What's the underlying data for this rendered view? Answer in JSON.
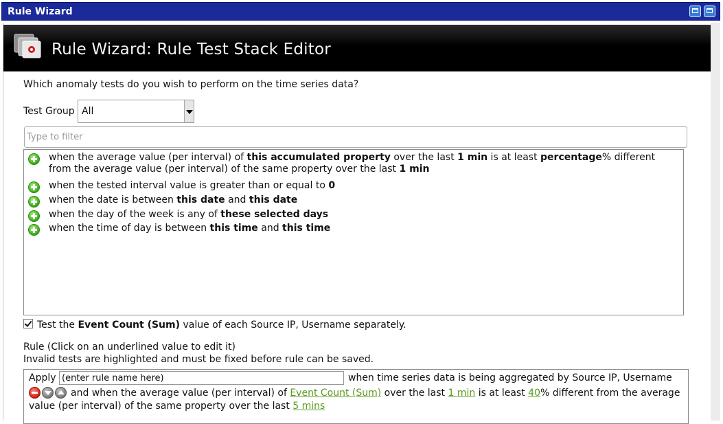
{
  "window": {
    "title": "Rule Wizard"
  },
  "header": {
    "title": "Rule Wizard: Rule Test Stack Editor"
  },
  "question": "Which anomaly tests do you wish to perform on the time series data?",
  "test_group": {
    "label": "Test Group",
    "selected": "All"
  },
  "filter": {
    "placeholder": "Type to filter",
    "value": ""
  },
  "tests": [
    {
      "parts": [
        {
          "t": "when the average value (per interval) of "
        },
        {
          "t": "this accumulated property",
          "b": true
        },
        {
          "t": " over the last "
        },
        {
          "t": "1 min",
          "b": true
        },
        {
          "t": " is at least "
        },
        {
          "t": "percentage",
          "b": true
        },
        {
          "t": "% different from the average value (per interval) of the same property over the last "
        },
        {
          "t": "1 min",
          "b": true
        }
      ]
    },
    {
      "parts": [
        {
          "t": "when the tested interval value is greater than or equal to "
        },
        {
          "t": "0",
          "b": true
        }
      ]
    },
    {
      "parts": [
        {
          "t": "when the date is between "
        },
        {
          "t": "this date",
          "b": true
        },
        {
          "t": " and "
        },
        {
          "t": "this date",
          "b": true
        }
      ]
    },
    {
      "parts": [
        {
          "t": "when the day of the week is any of "
        },
        {
          "t": "these selected days",
          "b": true
        }
      ]
    },
    {
      "parts": [
        {
          "t": "when the time of day is between "
        },
        {
          "t": "this time",
          "b": true
        },
        {
          "t": " and "
        },
        {
          "t": "this time",
          "b": true
        }
      ]
    }
  ],
  "separate_checkbox": {
    "checked": true,
    "prefix": "Test the ",
    "bold": "Event Count (Sum)",
    "suffix": " value of each Source IP, Username separately."
  },
  "rule": {
    "heading1": "Rule (Click on an underlined value to edit it)",
    "heading2": "Invalid tests are highlighted and must be fixed before rule can be saved.",
    "apply_label": "Apply",
    "name_value": "(enter rule name here)",
    "line1_rest": "when time series data is being aggregated by Source IP, Username",
    "line2_parts": [
      {
        "t": "and when the average value (per interval) of "
      },
      {
        "t": "Event Count (Sum)",
        "link": true
      },
      {
        "t": " over the last "
      },
      {
        "t": "1 min",
        "link": true
      },
      {
        "t": " is at least "
      },
      {
        "t": "40",
        "link": true
      },
      {
        "t": "% different from the average value (per interval) of the same property over the last "
      },
      {
        "t": "5 mins",
        "link": true
      }
    ]
  }
}
